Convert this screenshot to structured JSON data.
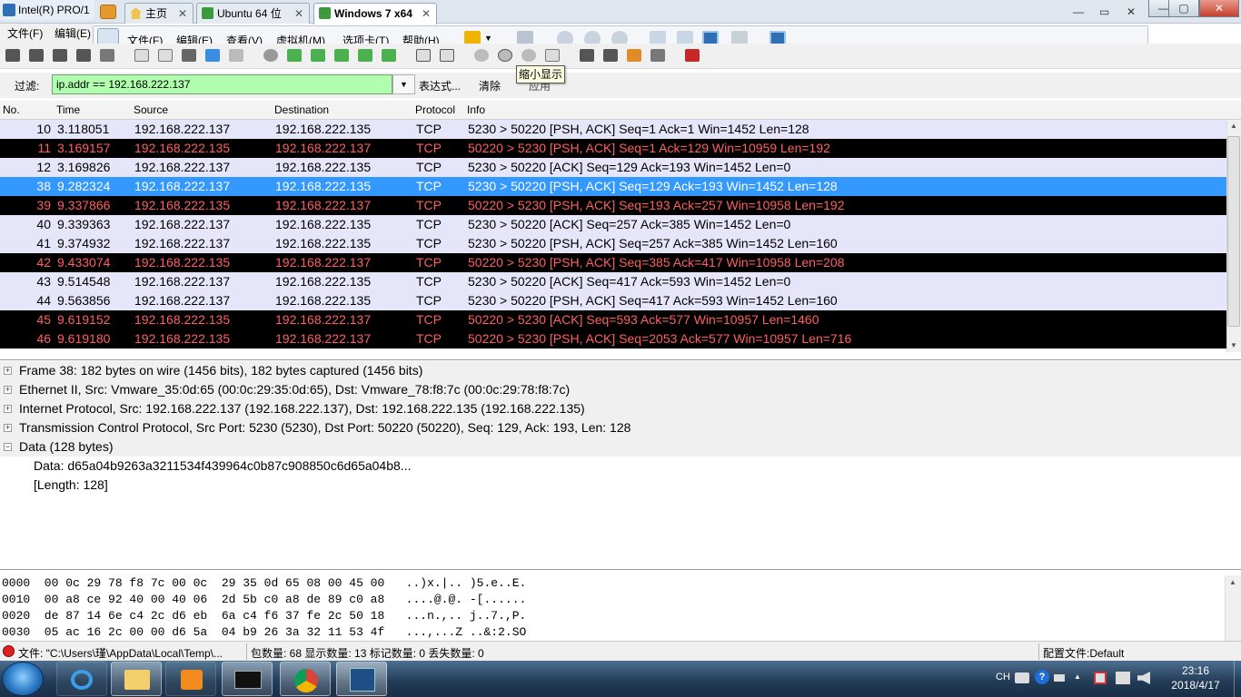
{
  "vm": {
    "ws_window_title": "Intel(R) PRO/1",
    "tabs": [
      {
        "label": "主页"
      },
      {
        "label": "Ubuntu 64 位"
      },
      {
        "label": "Windows 7 x64"
      }
    ],
    "tab_close": "✕",
    "menus": [
      "文件(F)",
      "编辑(E)",
      "查看(V)",
      "虚拟机(M)",
      "选项卡(T)",
      "帮助(H)"
    ],
    "win_min": "—",
    "win_max": "▢",
    "win_close": "✕",
    "inner_min": "—",
    "inner_restore": "▭",
    "inner_close": "✕"
  },
  "ws_menu": {
    "file": "文件(F)",
    "edit": "编辑(E)"
  },
  "tooltip": "缩小显示",
  "filter": {
    "label": "过滤:",
    "value": "ip.addr == 192.168.222.137",
    "expression": "表达式...",
    "clear": "清除",
    "apply": "应用"
  },
  "columns": {
    "no": "No.",
    "time": "Time",
    "source": "Source",
    "destination": "Destination",
    "protocol": "Protocol",
    "info": "Info"
  },
  "packets": [
    {
      "no": "10",
      "time": "3.118051",
      "src": "192.168.222.137",
      "dst": "192.168.222.135",
      "proto": "TCP",
      "info": "5230 > 50220 [PSH, ACK] Seq=1 Ack=1 Win=1452 Len=128",
      "style": "light"
    },
    {
      "no": "11",
      "time": "3.169157",
      "src": "192.168.222.135",
      "dst": "192.168.222.137",
      "proto": "TCP",
      "info": "50220 > 5230 [PSH, ACK] Seq=1 Ack=129 Win=10959 Len=192",
      "style": "dark"
    },
    {
      "no": "12",
      "time": "3.169826",
      "src": "192.168.222.137",
      "dst": "192.168.222.135",
      "proto": "TCP",
      "info": "5230 > 50220 [ACK] Seq=129 Ack=193 Win=1452 Len=0",
      "style": "light"
    },
    {
      "no": "38",
      "time": "9.282324",
      "src": "192.168.222.137",
      "dst": "192.168.222.135",
      "proto": "TCP",
      "info": "5230 > 50220 [PSH, ACK] Seq=129 Ack=193 Win=1452 Len=128",
      "style": "sel"
    },
    {
      "no": "39",
      "time": "9.337866",
      "src": "192.168.222.135",
      "dst": "192.168.222.137",
      "proto": "TCP",
      "info": "50220 > 5230 [PSH, ACK] Seq=193 Ack=257 Win=10958 Len=192",
      "style": "dark"
    },
    {
      "no": "40",
      "time": "9.339363",
      "src": "192.168.222.137",
      "dst": "192.168.222.135",
      "proto": "TCP",
      "info": "5230 > 50220 [ACK] Seq=257 Ack=385 Win=1452 Len=0",
      "style": "light"
    },
    {
      "no": "41",
      "time": "9.374932",
      "src": "192.168.222.137",
      "dst": "192.168.222.135",
      "proto": "TCP",
      "info": "5230 > 50220 [PSH, ACK] Seq=257 Ack=385 Win=1452 Len=160",
      "style": "light"
    },
    {
      "no": "42",
      "time": "9.433074",
      "src": "192.168.222.135",
      "dst": "192.168.222.137",
      "proto": "TCP",
      "info": "50220 > 5230 [PSH, ACK] Seq=385 Ack=417 Win=10958 Len=208",
      "style": "dark"
    },
    {
      "no": "43",
      "time": "9.514548",
      "src": "192.168.222.137",
      "dst": "192.168.222.135",
      "proto": "TCP",
      "info": "5230 > 50220 [ACK] Seq=417 Ack=593 Win=1452 Len=0",
      "style": "light"
    },
    {
      "no": "44",
      "time": "9.563856",
      "src": "192.168.222.137",
      "dst": "192.168.222.135",
      "proto": "TCP",
      "info": "5230 > 50220 [PSH, ACK] Seq=417 Ack=593 Win=1452 Len=160",
      "style": "light"
    },
    {
      "no": "45",
      "time": "9.619152",
      "src": "192.168.222.135",
      "dst": "192.168.222.137",
      "proto": "TCP",
      "info": "50220 > 5230 [ACK] Seq=593 Ack=577 Win=10957 Len=1460",
      "style": "dark"
    },
    {
      "no": "46",
      "time": "9.619180",
      "src": "192.168.222.135",
      "dst": "192.168.222.137",
      "proto": "TCP",
      "info": "50220 > 5230 [PSH, ACK] Seq=2053 Ack=577 Win=10957 Len=716",
      "style": "dark"
    }
  ],
  "details": {
    "frame": "Frame 38: 182 bytes on wire (1456 bits), 182 bytes captured (1456 bits)",
    "ethernet": "Ethernet II, Src: Vmware_35:0d:65 (00:0c:29:35:0d:65), Dst: Vmware_78:f8:7c (00:0c:29:78:f8:7c)",
    "ip": "Internet Protocol, Src: 192.168.222.137 (192.168.222.137), Dst: 192.168.222.135 (192.168.222.135)",
    "tcp": "Transmission Control Protocol, Src Port: 5230 (5230), Dst Port: 50220 (50220), Seq: 129, Ack: 193, Len: 128",
    "data": "Data (128 bytes)",
    "data_value": "Data: d65a04b9263a3211534f439964c0b87c908850c6d65a04b8...",
    "data_length": "[Length: 128]",
    "collapsed_sign": "+",
    "expanded_sign": "−"
  },
  "hex": [
    "0000  00 0c 29 78 f8 7c 00 0c  29 35 0d 65 08 00 45 00   ..)x.|.. )5.e..E.",
    "0010  00 a8 ce 92 40 00 40 06  2d 5b c0 a8 de 89 c0 a8   ....@.@. -[......",
    "0020  de 87 14 6e c4 2c d6 eb  6a c4 f6 37 fe 2c 50 18   ...n.,.. j..7.,P.",
    "0030  05 ac 16 2c 00 00 d6 5a  04 b9 26 3a 32 11 53 4f   ...,...Z ..&:2.SO"
  ],
  "status": {
    "file": "文件: \"C:\\Users\\瑾\\AppData\\Local\\Temp\\...",
    "counts": "包数量: 68 显示数量: 13 标记数量: 0 丢失数量: 0",
    "profile": "配置文件:Default"
  },
  "taskbar": {
    "tray_lang": "CH",
    "tray_help": "?",
    "tray_up": "▲",
    "clock_time": "23:16",
    "clock_date": "2018/4/17"
  },
  "scroll": {
    "up": "▲",
    "down": "▼",
    "dropdown": "▼"
  },
  "colors": {
    "match_bg": "#afffaf",
    "selected_row": "#3399ff",
    "dark_row_text": "#ff5f5f",
    "light_row": "#e6e6fa"
  }
}
